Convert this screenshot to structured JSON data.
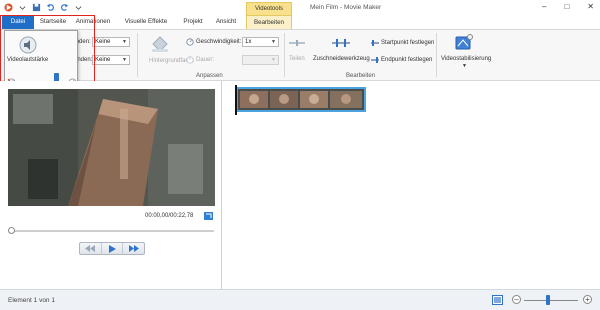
{
  "window": {
    "title": "Mein Film - Movie Maker",
    "contextual_group": "Videotools"
  },
  "tabs": [
    {
      "label": "Datei"
    },
    {
      "label": "Startseite"
    },
    {
      "label": "Animationen"
    },
    {
      "label": "Visuelle Effekte"
    },
    {
      "label": "Projekt"
    },
    {
      "label": "Ansicht"
    },
    {
      "label": "Bearbeiten"
    }
  ],
  "ribbon": {
    "audio": {
      "volume_label": "Videolautstärke",
      "fade_in_label": "Einblenden:",
      "fade_in_value": "Keine",
      "fade_out_label": "Ausblenden:",
      "fade_out_value": "Keine"
    },
    "adjust": {
      "background_color_label": "Hintergrundfarbe",
      "speed_label": "Geschwindigkeit:",
      "speed_value": "1x",
      "duration_label": "Dauer:",
      "group_label": "Anpassen"
    },
    "edit": {
      "split_label": "Teilen",
      "trim_tool_label": "Zuschneidewerkzeug",
      "set_start_label": "Startpunkt festlegen",
      "set_end_label": "Endpunkt festlegen",
      "group_label": "Bearbeiten"
    },
    "stabilization": {
      "label": "Videostabilisierung"
    }
  },
  "volume_popup": {
    "level": 0.8
  },
  "preview": {
    "timecode": "00:00,00/00:22,78",
    "position": 0.0
  },
  "status": {
    "text": "Element 1 von 1",
    "zoom_level": 0.45
  },
  "colors": {
    "file_tab": "#1f6fc9",
    "context_tab": "#f8e08c",
    "clip_border": "#4aa3df",
    "highlight_box": "#e0231c"
  }
}
